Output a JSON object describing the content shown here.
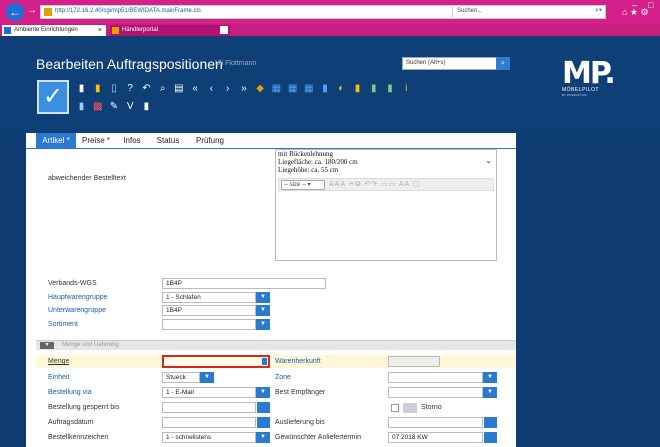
{
  "browser": {
    "url": "http://172.16.2.40/cgi/mp51/BEWIDATA.mainFrame.cls",
    "address_actions": "▾ C",
    "search_placeholder": "Suchen...",
    "tabs": [
      {
        "label": "Ambiente Einrichtungen"
      },
      {
        "label": "Händlerportal"
      }
    ]
  },
  "app": {
    "title": "Bearbeiten Auftragspositionen",
    "user": "Uli Flottmann",
    "search_placeholder": "Suchen (Alt+s)",
    "logo_main": "MP.",
    "logo_sub": "MÖBELPILOT",
    "logo_sub2": "BY INTERACTIVE"
  },
  "content_tabs": [
    {
      "label": "Artikel *",
      "selected": true
    },
    {
      "label": "Preise *"
    },
    {
      "label": "Infos"
    },
    {
      "label": "Status"
    },
    {
      "label": "Prüfung"
    }
  ],
  "editor": {
    "lines": [
      "mit Rückenlehnung",
      "Liegefläche: ca. 180/200 cm",
      "Liegehöhe: ca. 55 cm"
    ],
    "size_label": "-- size --"
  },
  "form": {
    "abweichender_label": "abweichender Bestelltext",
    "verbands_wgs": {
      "label": "Verbands-WGS",
      "value": "1B4P"
    },
    "hauptwarengruppe": {
      "label": "Hauptwarengruppe",
      "value": "1 - Schlafen"
    },
    "unterwarengruppe": {
      "label": "Unterwarengruppe",
      "value": "1B4P"
    },
    "sortiment": {
      "label": "Sortiment",
      "value": ""
    },
    "section_title": "Menge und Lieferung",
    "menge": {
      "label": "Menge",
      "value": ""
    },
    "warenherkunft": {
      "label": "Warenherkunft",
      "value": ""
    },
    "einheit": {
      "label": "Einheit",
      "value": "Stueck"
    },
    "zone": {
      "label": "Zone",
      "value": ""
    },
    "bestellung_via": {
      "label": "Bestellung via",
      "value": "1 - E-Mail"
    },
    "best_empfaenger": {
      "label": "Best Empfänger",
      "value": ""
    },
    "gesperrt_bis": {
      "label": "Bestellung gesperrt bis",
      "value": ""
    },
    "storno": {
      "label": "Storno"
    },
    "auftragsdatum": {
      "label": "Auftragsdatum",
      "value": ""
    },
    "auslieferung_bis": {
      "label": "Auslieferung bis",
      "value": ""
    },
    "bestellkennzeichen": {
      "label": "Bestellkennzeichen",
      "value": "1 - schnellstens"
    },
    "gewuenschter_liefertermin": {
      "label": "Gewünschter Anliefertermin",
      "value": "07.2018 KW"
    }
  },
  "colors": {
    "browser_accent": "#d4208a",
    "app_header": "#0e3f77",
    "accent_blue": "#2a7bd0",
    "focus_red": "#d5281f"
  }
}
